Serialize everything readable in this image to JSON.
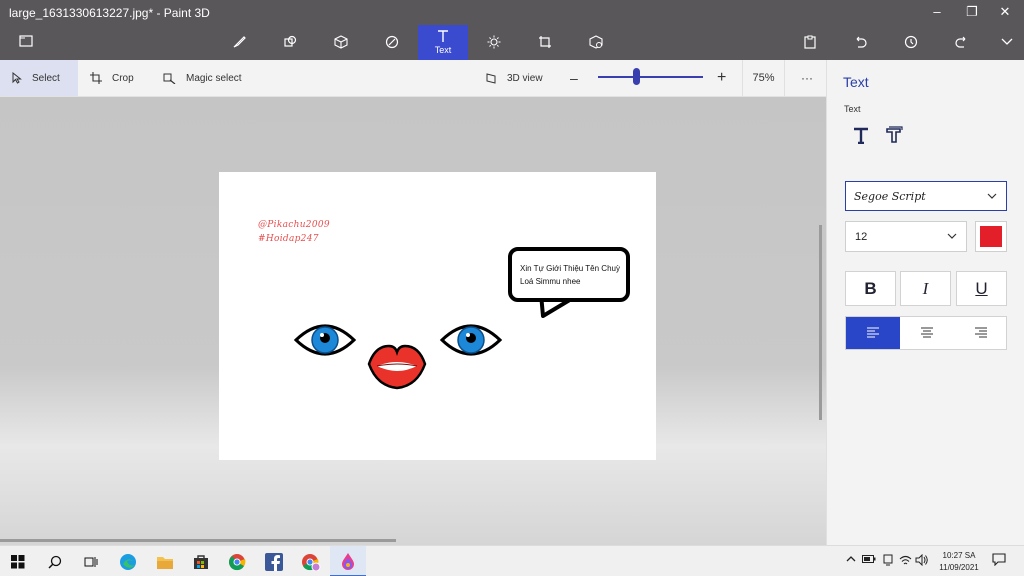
{
  "window": {
    "title": "large_1631330613227.jpg* - Paint 3D",
    "controls": [
      "minimize",
      "restore",
      "close"
    ]
  },
  "main_toolbar": {
    "tools": [
      {
        "name": "menu-icon"
      },
      {
        "name": "brushes-icon"
      },
      {
        "name": "2d-shapes-icon"
      },
      {
        "name": "3d-shapes-icon"
      },
      {
        "name": "stickers-icon"
      },
      {
        "name": "text-icon",
        "label": "Text",
        "active": true
      },
      {
        "name": "effects-icon"
      },
      {
        "name": "canvas-icon"
      },
      {
        "name": "3d-library-icon"
      }
    ],
    "right_tools": [
      "paste-icon",
      "undo-icon",
      "history-icon",
      "redo-icon",
      "expand-icon"
    ],
    "active_color": "#3b4bd0"
  },
  "sub_toolbar": {
    "select_label": "Select",
    "crop_label": "Crop",
    "magic_select_label": "Magic select",
    "view_3d_label": "3D view",
    "zoom_label": "75%",
    "zoom_fraction": 0.34,
    "more_label": "···"
  },
  "canvas": {
    "signature_line1": "@Pikachu2009",
    "signature_line2": "#Hoidap247",
    "signature_color": "#e64f4f",
    "bubble_line1": "Xin Tự Giới Thiệu Tên Chuỳ",
    "bubble_line2": "Loá Simmu nhee",
    "eye_color": "#1e88d8",
    "lips_color": "#e8322a"
  },
  "panel": {
    "title": "Text",
    "subtitle": "Text",
    "font_name": "Segoe Script",
    "font_size": "12",
    "text_color": "#e3202a",
    "bold_label": "B",
    "italic_label": "I",
    "underline_label": "U",
    "alignments": [
      "left",
      "center",
      "right"
    ],
    "active_alignment": "left",
    "accent_color": "#2a3fa8"
  },
  "taskbar": {
    "apps": [
      "start-icon",
      "search-icon",
      "task-view-icon",
      "edge-icon",
      "file-explorer-icon",
      "store-icon",
      "chrome-icon",
      "facebook-icon",
      "chrome-profile-icon",
      "paint-3d-icon"
    ],
    "time": "10:27 SA",
    "date": "11/09/2021"
  }
}
